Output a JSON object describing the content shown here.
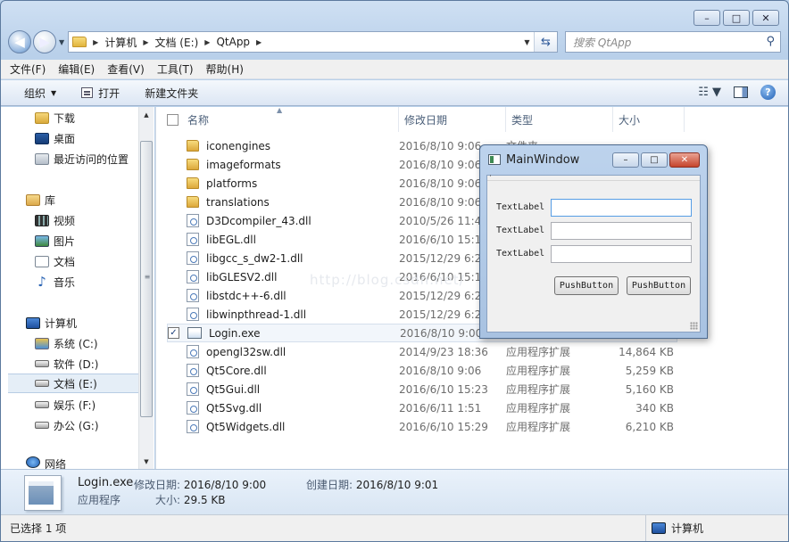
{
  "window": {
    "caption_buttons": [
      "–",
      "□",
      "✕"
    ]
  },
  "address": {
    "crumbs": [
      "计算机",
      "文档 (E:)",
      "QtApp"
    ],
    "search_placeholder": "搜索 QtApp"
  },
  "menu": [
    "文件(F)",
    "编辑(E)",
    "查看(V)",
    "工具(T)",
    "帮助(H)"
  ],
  "toolbar": {
    "organize": "组织",
    "open": "打开",
    "new_folder": "新建文件夹"
  },
  "nav": {
    "favorites": [
      "下载",
      "桌面",
      "最近访问的位置"
    ],
    "library_header": "库",
    "libraries": [
      "视频",
      "图片",
      "文档",
      "音乐"
    ],
    "computer_header": "计算机",
    "drives": [
      "系统 (C:)",
      "软件 (D:)",
      "文档 (E:)",
      "娱乐 (F:)",
      "办公 (G:)"
    ],
    "network_header": "网络"
  },
  "columns": [
    "名称",
    "修改日期",
    "类型",
    "大小"
  ],
  "files": [
    {
      "name": "iconengines",
      "date": "2016/8/10 9:06",
      "type": "文件夹",
      "size": "",
      "kind": "folder"
    },
    {
      "name": "imageformats",
      "date": "2016/8/10 9:06",
      "type": "",
      "size": "",
      "kind": "folder"
    },
    {
      "name": "platforms",
      "date": "2016/8/10 9:06",
      "type": "",
      "size": "",
      "kind": "folder"
    },
    {
      "name": "translations",
      "date": "2016/8/10 9:06",
      "type": "",
      "size": "",
      "kind": "folder"
    },
    {
      "name": "D3Dcompiler_43.dll",
      "date": "2010/5/26 11:4",
      "type": "",
      "size": "",
      "kind": "dll"
    },
    {
      "name": "libEGL.dll",
      "date": "2016/6/10 15:1",
      "type": "",
      "size": "",
      "kind": "dll"
    },
    {
      "name": "libgcc_s_dw2-1.dll",
      "date": "2015/12/29 6:2",
      "type": "",
      "size": "",
      "kind": "dll"
    },
    {
      "name": "libGLESV2.dll",
      "date": "2016/6/10 15:1",
      "type": "",
      "size": "",
      "kind": "dll"
    },
    {
      "name": "libstdc++-6.dll",
      "date": "2015/12/29 6:2",
      "type": "",
      "size": "",
      "kind": "dll"
    },
    {
      "name": "libwinpthread-1.dll",
      "date": "2015/12/29 6:2",
      "type": "",
      "size": "",
      "kind": "dll"
    },
    {
      "name": "Login.exe",
      "date": "2016/8/10 9:00",
      "type": "",
      "size": "",
      "kind": "exe"
    },
    {
      "name": "opengl32sw.dll",
      "date": "2014/9/23 18:36",
      "type": "应用程序扩展",
      "size": "14,864 KB",
      "kind": "dll"
    },
    {
      "name": "Qt5Core.dll",
      "date": "2016/8/10 9:06",
      "type": "应用程序扩展",
      "size": "5,259 KB",
      "kind": "dll"
    },
    {
      "name": "Qt5Gui.dll",
      "date": "2016/6/10 15:23",
      "type": "应用程序扩展",
      "size": "5,160 KB",
      "kind": "dll"
    },
    {
      "name": "Qt5Svg.dll",
      "date": "2016/6/11 1:51",
      "type": "应用程序扩展",
      "size": "340 KB",
      "kind": "dll"
    },
    {
      "name": "Qt5Widgets.dll",
      "date": "2016/6/10 15:29",
      "type": "应用程序扩展",
      "size": "6,210 KB",
      "kind": "dll"
    }
  ],
  "watermark": "http://blog.csdn.net/",
  "details": {
    "name": "Login.exe",
    "type": "应用程序",
    "modified_label": "修改日期:",
    "modified_value": "2016/8/10 9:00",
    "created_label": "创建日期:",
    "created_value": "2016/8/10 9:01",
    "size_label": "大小:",
    "size_value": "29.5 KB"
  },
  "status": {
    "left": "已选择 1 项",
    "right": "计算机"
  },
  "qt_window": {
    "title": "MainWindow",
    "labels": [
      "TextLabel",
      "TextLabel",
      "TextLabel"
    ],
    "buttons": [
      "PushButton",
      "PushButton"
    ],
    "caption_buttons": [
      "–",
      "□",
      "✕"
    ]
  }
}
